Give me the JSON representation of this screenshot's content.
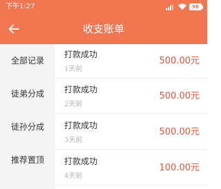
{
  "status_bar": {
    "time": "下午1:27",
    "battery": "98"
  },
  "header": {
    "title": "收支账单"
  },
  "sidebar": {
    "items": [
      {
        "label": "全部记录"
      },
      {
        "label": "徒弟分成"
      },
      {
        "label": "徒孙分成"
      },
      {
        "label": "推荐置顶"
      }
    ]
  },
  "records": [
    {
      "title": "打款成功",
      "time": "1天前",
      "amount": "500.00元"
    },
    {
      "title": "打款成功",
      "time": "2天前",
      "amount": "500.00元"
    },
    {
      "title": "打款成功",
      "time": "3天前",
      "amount": "500.00元"
    },
    {
      "title": "打款成功",
      "time": "4天前",
      "amount": "100.00元"
    }
  ],
  "colors": {
    "header": "#f27650",
    "amount": "#e0543c",
    "sidebar_bg": "#f3f3f3"
  },
  "icons": {
    "back": "arrow-left-icon",
    "signal": "signal-icon",
    "wifi": "wifi-icon",
    "battery": "battery-icon"
  }
}
